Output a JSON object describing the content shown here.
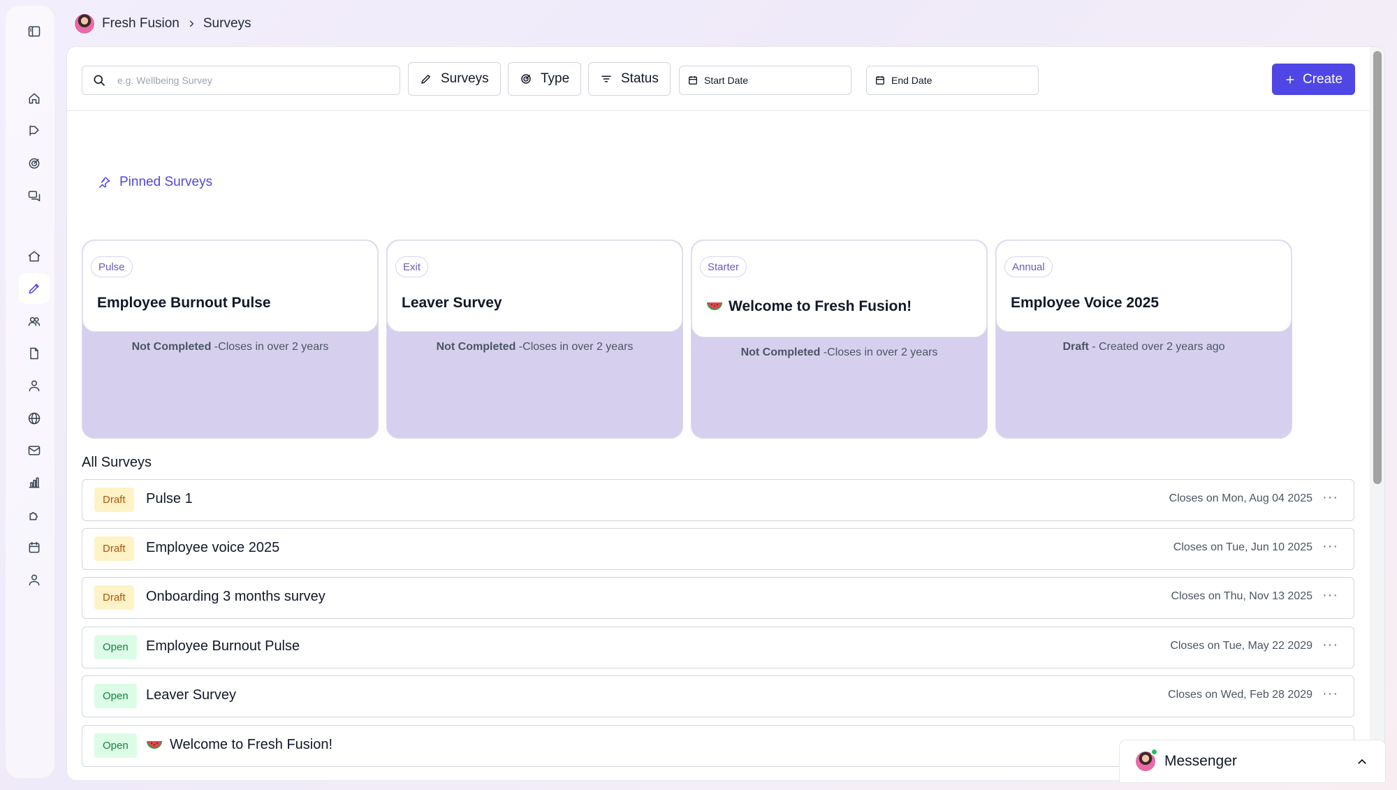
{
  "breadcrumb": {
    "org": "Fresh Fusion",
    "page": "Surveys"
  },
  "toolbar": {
    "search_placeholder": "e.g. Wellbeing Survey",
    "surveys_label": "Surveys",
    "type_label": "Type",
    "status_label": "Status",
    "start_date_label": "Start Date",
    "end_date_label": "End Date",
    "create_label": "Create"
  },
  "pinned": {
    "title": "Pinned Surveys",
    "cards": [
      {
        "type": "Pulse",
        "title": "Employee Burnout Pulse",
        "status": "Not Completed",
        "detail": " -Closes in over 2 years"
      },
      {
        "type": "Exit",
        "title": "Leaver Survey",
        "status": "Not Completed",
        "detail": " -Closes in over 2 years"
      },
      {
        "type": "Starter",
        "title": "Welcome to Fresh Fusion!",
        "status": "Not Completed",
        "detail": " -Closes in over 2 years"
      },
      {
        "type": "Annual",
        "title": "Employee Voice 2025",
        "status": "Draft",
        "detail": " - Created over 2 years ago"
      }
    ]
  },
  "all_surveys": {
    "title": "All Surveys",
    "rows": [
      {
        "status": "Draft",
        "title": "Pulse 1",
        "closes": "Closes on Mon, Aug 04 2025"
      },
      {
        "status": "Draft",
        "title": "Employee voice 2025",
        "closes": "Closes on Tue, Jun 10 2025"
      },
      {
        "status": "Draft",
        "title": "Onboarding 3 months survey",
        "closes": "Closes on Thu, Nov 13 2025"
      },
      {
        "status": "Open",
        "title": "Employee Burnout Pulse",
        "closes": "Closes on Tue, May 22 2029"
      },
      {
        "status": "Open",
        "title": "Leaver Survey",
        "closes": "Closes on Wed, Feb 28 2029"
      },
      {
        "status": "Open",
        "title": "Welcome to Fresh Fusion!",
        "closes": ""
      }
    ],
    "more_label": "···"
  },
  "messenger": {
    "label": "Messenger"
  },
  "colors": {
    "accent": "#4f46e5",
    "pinned_card_bg": "#d6d0ee",
    "draft_bg": "#fef3c7",
    "open_bg": "#dcfce7"
  }
}
